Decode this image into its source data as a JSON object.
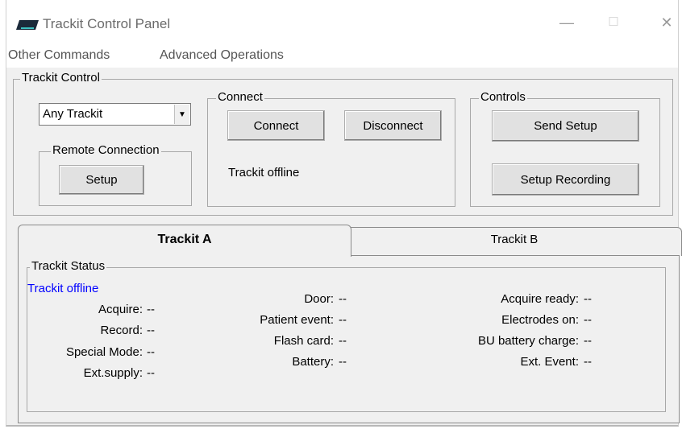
{
  "window": {
    "title": "Trackit Control Panel",
    "minimize": "—",
    "maximize": "☐",
    "close": "✕"
  },
  "menu": {
    "items": [
      "Other Commands",
      "Advanced Operations"
    ]
  },
  "trackit_control": {
    "label": "Trackit Control",
    "device_select": {
      "value": "Any Trackit"
    },
    "remote_connection": {
      "label": "Remote Connection",
      "setup_button": "Setup"
    },
    "connect": {
      "label": "Connect",
      "connect_button": "Connect",
      "disconnect_button": "Disconnect",
      "status": "Trackit offline"
    },
    "controls": {
      "label": "Controls",
      "send_setup_button": "Send Setup",
      "setup_recording_button": "Setup Recording"
    }
  },
  "tabs": [
    "Trackit A",
    "Trackit B"
  ],
  "status": {
    "label": "Trackit Status",
    "state": "Trackit offline",
    "state_color": "#0000ff",
    "col1": [
      {
        "label": "Acquire:",
        "value": "--"
      },
      {
        "label": "Record:",
        "value": "--"
      },
      {
        "label": "Special Mode:",
        "value": "--"
      },
      {
        "label": "Ext.supply:",
        "value": "--"
      }
    ],
    "col2": [
      {
        "label": "Door:",
        "value": "--"
      },
      {
        "label": "Patient event:",
        "value": "--"
      },
      {
        "label": "Flash card:",
        "value": "--"
      },
      {
        "label": "Battery:",
        "value": "--"
      }
    ],
    "col3": [
      {
        "label": "Acquire ready:",
        "value": "--"
      },
      {
        "label": "Electrodes on:",
        "value": "--"
      },
      {
        "label": "BU battery charge:",
        "value": "--"
      },
      {
        "label": "Ext. Event:",
        "value": "--"
      }
    ]
  }
}
